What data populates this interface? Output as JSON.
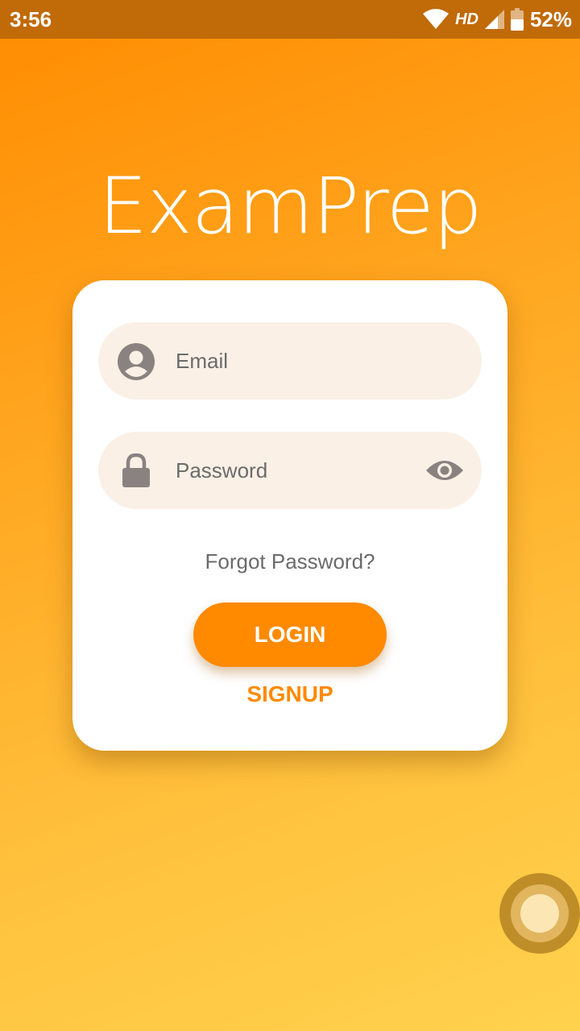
{
  "status_bar": {
    "time": "3:56",
    "network_label": "HD",
    "battery_percent": "52%",
    "icons": [
      "wifi-icon",
      "signal-icon",
      "battery-icon"
    ]
  },
  "app": {
    "title": "ExamPrep"
  },
  "login_form": {
    "email": {
      "placeholder": "Email",
      "value": "",
      "icon": "account-circle-icon"
    },
    "password": {
      "placeholder": "Password",
      "value": "",
      "icon": "lock-icon",
      "toggle_icon": "eye-icon"
    },
    "forgot_password_label": "Forgot Password?",
    "login_label": "LOGIN",
    "signup_label": "SIGNUP"
  },
  "colors": {
    "accent": "#ff8a00",
    "status_bar": "#c06a08",
    "field_background": "#faf0e6",
    "text_muted": "#6b6b6b"
  }
}
